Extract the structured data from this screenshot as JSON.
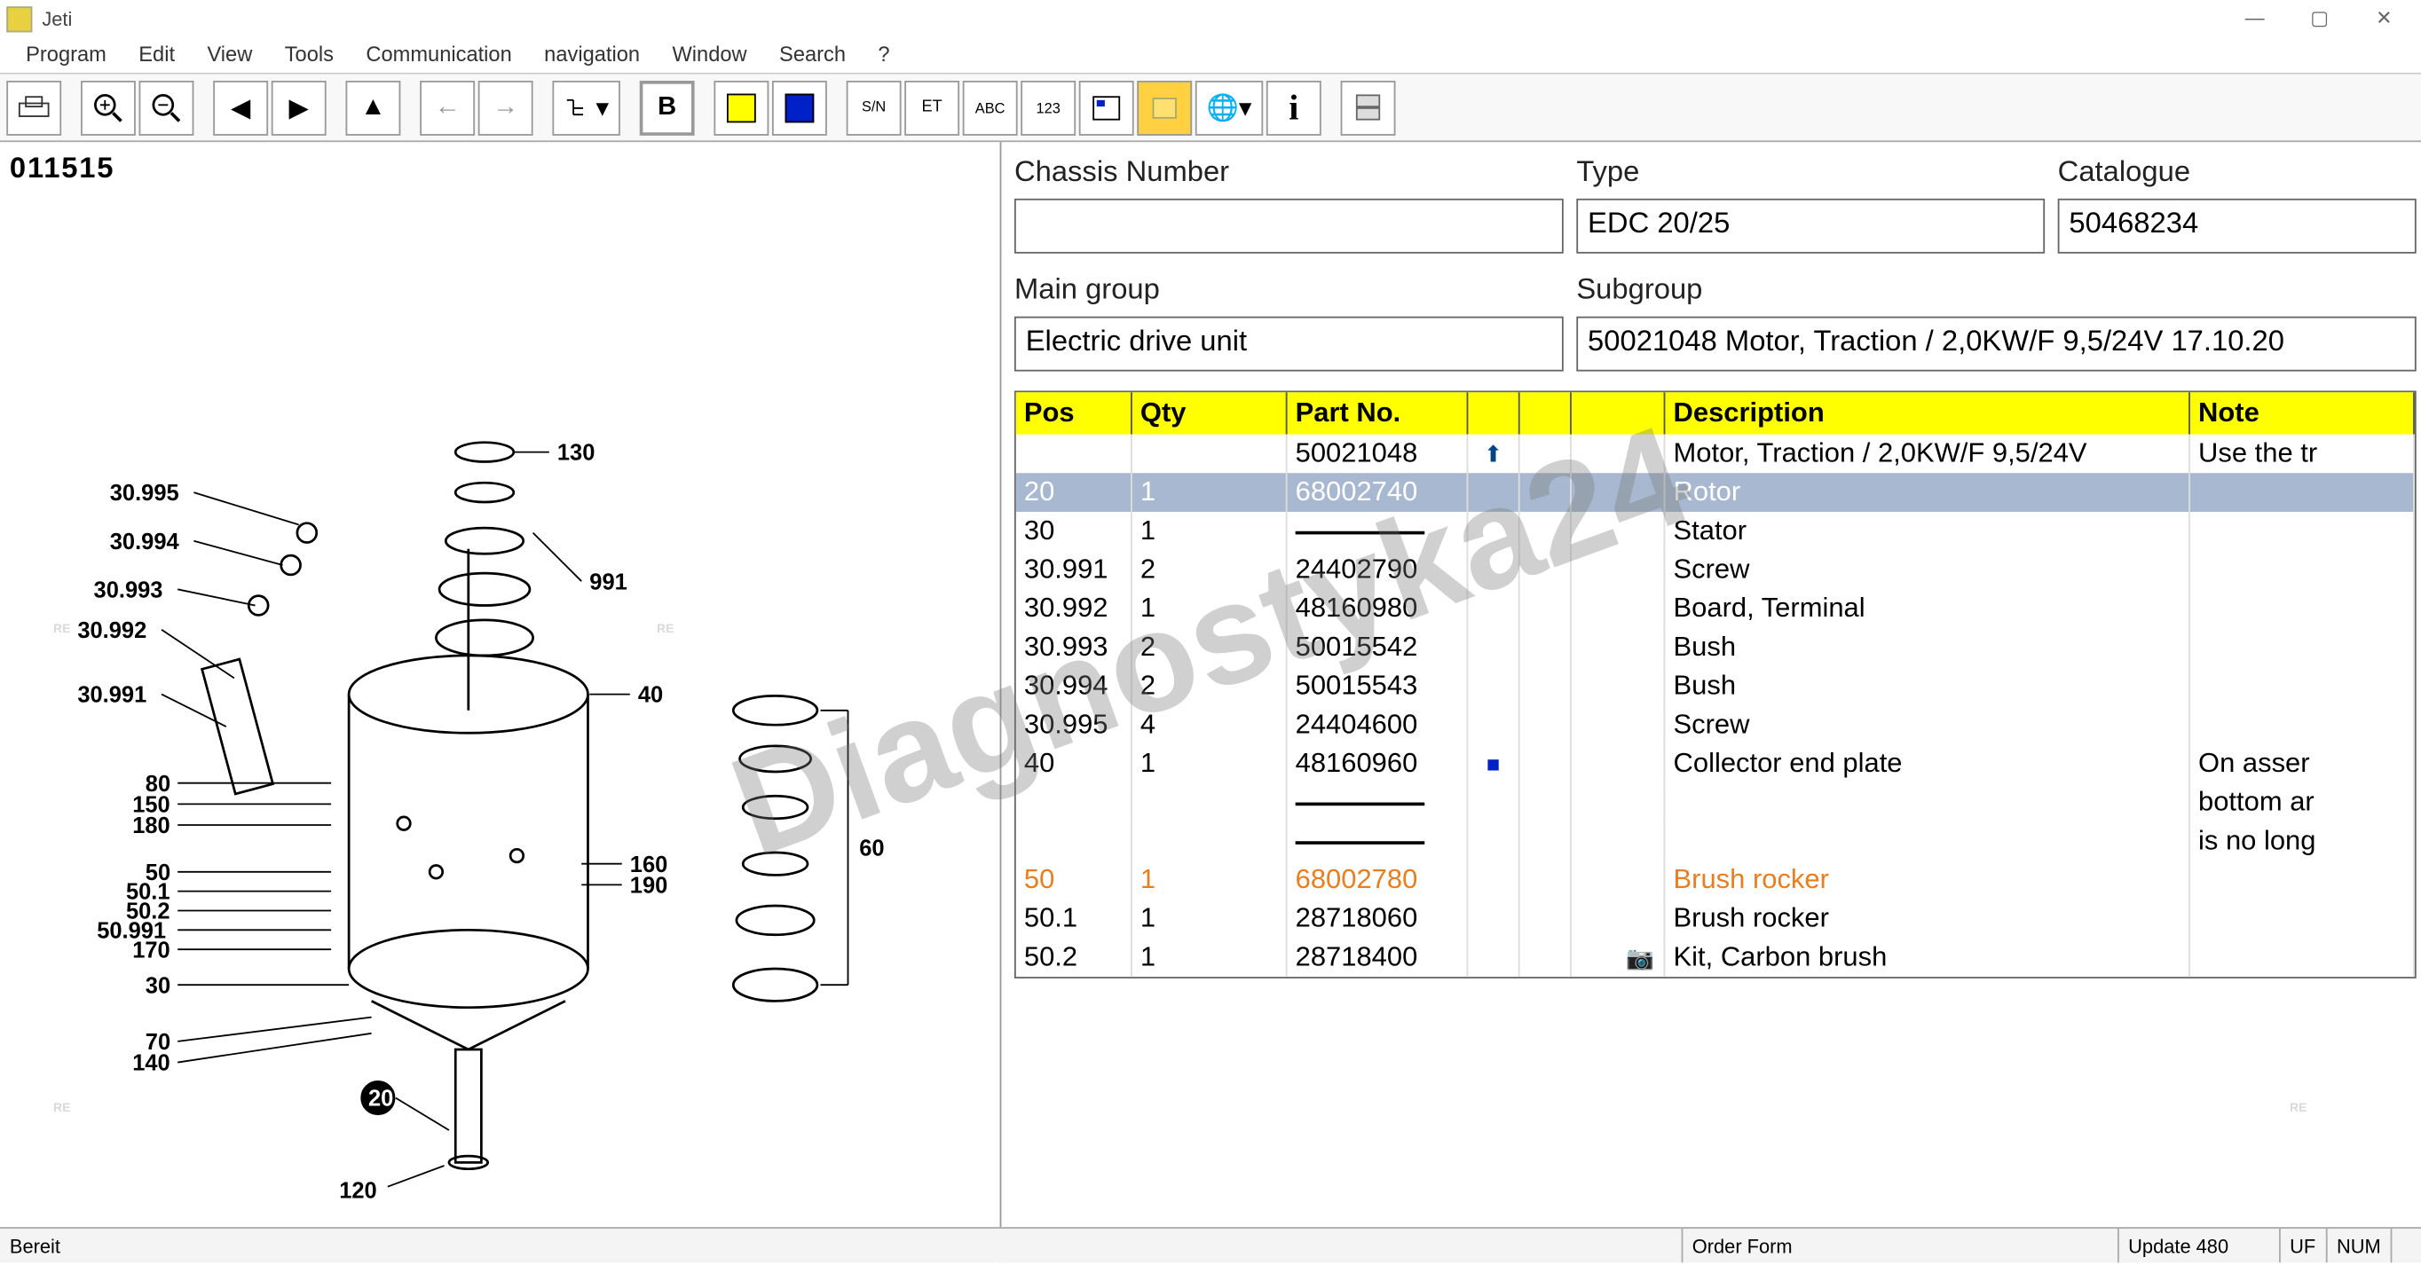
{
  "app": {
    "title": "Jeti"
  },
  "menubar": {
    "items": [
      "Program",
      "Edit",
      "View",
      "Tools",
      "Communication",
      "navigation",
      "Window",
      "Search",
      "?"
    ]
  },
  "drawing": {
    "id": "011515"
  },
  "info": {
    "chassis": {
      "label": "Chassis Number",
      "value": ""
    },
    "type": {
      "label": "Type",
      "value": "EDC 20/25"
    },
    "catalogue": {
      "label": "Catalogue",
      "value": "50468234"
    },
    "maingroup": {
      "label": "Main group",
      "value": "Electric drive unit"
    },
    "subgroup": {
      "label": "Subgroup",
      "value": "50021048  Motor, Traction / 2,0KW/F 9,5/24V 17.10.20"
    }
  },
  "table": {
    "headers": {
      "pos": "Pos",
      "qty": "Qty",
      "part": "Part No.",
      "desc": "Description",
      "note": "Note"
    },
    "rows": [
      {
        "pos": "",
        "qty": "",
        "part": "50021048",
        "i1": "⬆",
        "desc": "Motor, Traction / 2,0KW/F 9,5/24V",
        "note": "Use the tr",
        "style": ""
      },
      {
        "pos": "20",
        "qty": "1",
        "part": "68002740",
        "desc": "Rotor",
        "note": "",
        "style": "selected"
      },
      {
        "pos": "30",
        "qty": "1",
        "part": "—",
        "desc": "Stator",
        "note": "",
        "style": "",
        "dash": true
      },
      {
        "pos": "30.991",
        "qty": "2",
        "part": "24402790",
        "desc": "Screw",
        "note": "",
        "style": ""
      },
      {
        "pos": "30.992",
        "qty": "1",
        "part": "48160980",
        "desc": "Board, Terminal",
        "note": "",
        "style": ""
      },
      {
        "pos": "30.993",
        "qty": "2",
        "part": "50015542",
        "desc": "Bush",
        "note": "",
        "style": ""
      },
      {
        "pos": "30.994",
        "qty": "2",
        "part": "50015543",
        "desc": "Bush",
        "note": "",
        "style": ""
      },
      {
        "pos": "30.995",
        "qty": "4",
        "part": "24404600",
        "desc": "Screw",
        "note": "",
        "style": ""
      },
      {
        "pos": "40",
        "qty": "1",
        "part": "48160960",
        "i1": "■",
        "i1color": "#0020c8",
        "desc": "Collector end plate",
        "note": "On asser",
        "style": ""
      },
      {
        "pos": "",
        "qty": "",
        "part": "—",
        "desc": "",
        "note": "bottom ar",
        "style": "",
        "dash": true
      },
      {
        "pos": "",
        "qty": "",
        "part": "—",
        "desc": "",
        "note": "is no long",
        "style": "",
        "dash": true
      },
      {
        "pos": "50",
        "qty": "1",
        "part": "68002780",
        "desc": "Brush rocker",
        "note": "",
        "style": "orange"
      },
      {
        "pos": "50.1",
        "qty": "1",
        "part": "28718060",
        "desc": "Brush rocker",
        "note": "",
        "style": ""
      },
      {
        "pos": "50.2",
        "qty": "1",
        "part": "28718400",
        "i3": "📷",
        "desc": "Kit, Carbon brush",
        "note": "",
        "style": ""
      }
    ]
  },
  "callouts": {
    "c130": "130",
    "c991": "991",
    "c40": "40",
    "c60": "60",
    "c80": "80",
    "c150": "150",
    "c180": "180",
    "c50": "50",
    "c501": "50.1",
    "c502": "50.2",
    "c50991": "50.991",
    "c170": "170",
    "c30": "30",
    "c70": "70",
    "c140": "140",
    "c20": "20",
    "c120": "120",
    "c160": "160",
    "c190": "190",
    "c30995": "30.995",
    "c30994": "30.994",
    "c30993": "30.993",
    "c30992": "30.992",
    "c30991": "30.991"
  },
  "status": {
    "ready": "Bereit",
    "orderform": "Order Form",
    "update": "Update 480",
    "uf": "UF",
    "num": "NUM"
  },
  "watermark": "Diagnostyka24",
  "re": "RE"
}
